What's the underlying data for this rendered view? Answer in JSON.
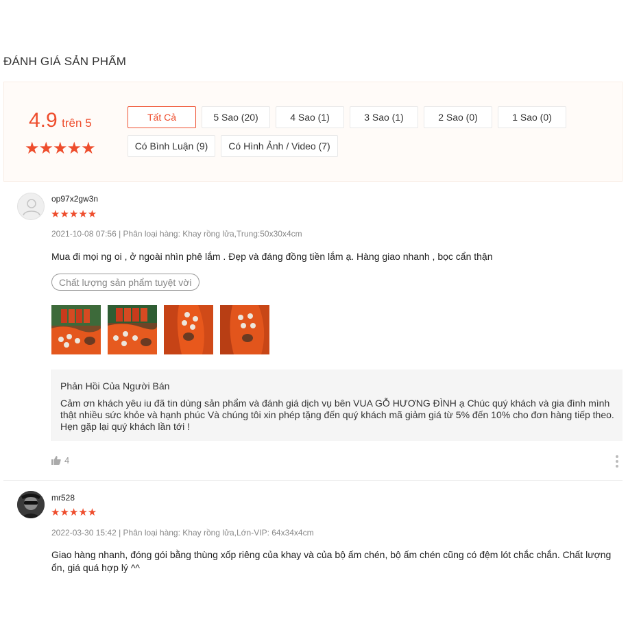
{
  "section_title": "ĐÁNH GIÁ SẢN PHẨM",
  "overview": {
    "score": "4.9",
    "score_suffix": "trên 5",
    "rating": 4.9,
    "stars": "★★★★★",
    "filters": [
      {
        "label": "Tất Cả",
        "active": true
      },
      {
        "label": "5 Sao (20)",
        "active": false
      },
      {
        "label": "4 Sao (1)",
        "active": false
      },
      {
        "label": "3 Sao (1)",
        "active": false
      },
      {
        "label": "2 Sao (0)",
        "active": false
      },
      {
        "label": "1 Sao (0)",
        "active": false
      },
      {
        "label": "Có Bình Luận (9)",
        "active": false
      },
      {
        "label": "Có Hình Ảnh / Video (7)",
        "active": false
      }
    ]
  },
  "colors": {
    "accent": "#ee4d2d",
    "overview_bg": "#fffbf8"
  },
  "reviews": [
    {
      "username": "op97x2gw3n",
      "rating": 5,
      "stars": "★★★★★",
      "meta": "2021-10-08 07:56 | Phân loại hàng: Khay rồng lửa,Trung:50x30x4cm",
      "text": "Mua đi mọi ng oi , ở ngoài nhìn phê lắm . Đẹp và đáng đồng tiền lắm ạ. Hàng giao nhanh , bọc cẩn thận",
      "tag": "Chất lượng sản phẩm tuyệt vời",
      "reply_title": "Phản Hồi Của Người Bán",
      "reply_text": "Cảm ơn khách yêu iu đã tin dùng sản phẩm và đánh giá dịch vụ bên VUA GỖ HƯƠNG ĐÌNH ạ Chúc quý khách và gia đình mình thật nhiều sức khỏe và hạnh phúc Và chúng tôi xin phép tặng đến quý khách mã giảm giá từ 5% đến 10% cho đơn hàng tiếp theo. Hẹn gặp lại quý khách lần tới !",
      "likes": "4"
    },
    {
      "username": "mr528",
      "rating": 5,
      "stars": "★★★★★",
      "meta": "2022-03-30 15:42 | Phân loại hàng: Khay rồng lửa,Lớn-VIP: 64x34x4cm",
      "text": "Giao hàng nhanh, đóng gói bằng thùng xốp riêng của khay và của bộ ấm chén, bộ ấm chén cũng có đệm lót chắc chắn. Chất lượng ổn, giá quá hợp lý ^^"
    }
  ]
}
